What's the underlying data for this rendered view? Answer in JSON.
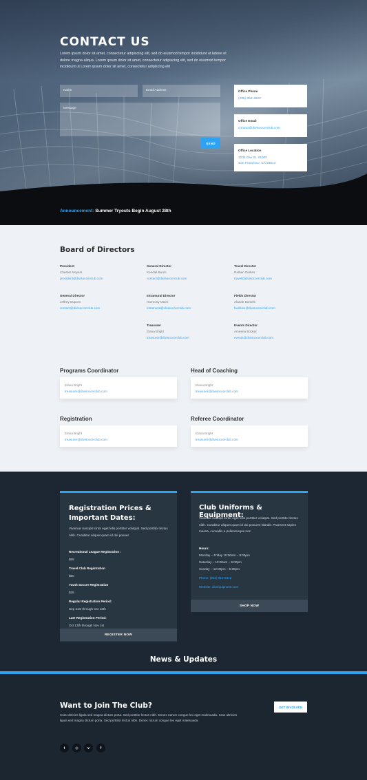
{
  "hero": {
    "title": "CONTACT US",
    "text": "Lorem ipsum dolor sit amet, consectetur adipiscing elit, sed do eiusmod tempor incididunt ut labore et dolore magna aliqua. Lorem ipsum dolor sit amet, consectetur adipiscing elit, sed do eiusmod tempor incididunt ut Lorem ipsum dolor sit amet, consectetur adipiscing elit",
    "form": {
      "name_placeholder": "Name",
      "email_placeholder": "Email Address",
      "message_placeholder": "Message",
      "send_label": "SEND"
    },
    "contact": [
      {
        "title": "Office Phone",
        "lines": [
          "(235) 352-4622"
        ]
      },
      {
        "title": "Office Email",
        "lines": [
          "contact@divisoccerclub.com"
        ]
      },
      {
        "title": "Office Location",
        "lines": [
          "1234 Divi St. #1000",
          "San Francisco, CA 93513"
        ]
      }
    ]
  },
  "announcement": {
    "label": "Announcement:",
    "text": "Summer Tryouts Begin August 28th"
  },
  "board": {
    "title": "Board of Directors",
    "members": [
      {
        "role": "President",
        "name": "Chester Meyers",
        "email": "president@divisoccerclub.com"
      },
      {
        "role": "General Director",
        "name": "Kendall Burch",
        "email": "contact@divisoccerclub.com"
      },
      {
        "role": "Travel Director",
        "name": "Rathan Parkes",
        "email": "travel@divisoccerclub.com"
      },
      {
        "role": "General Director",
        "name": "Jeffrey Dupont",
        "email": "contact@divisoccerclub.com"
      },
      {
        "role": "Intramural Director",
        "name": "Harmony Mack",
        "email": "intramural@divisoccerclub.com"
      },
      {
        "role": "Fields Director",
        "name": "Alanah Daniels",
        "email": "facilities@divisoccerclub.com"
      },
      {
        "role": "Treasurer",
        "name": "Elana Bright",
        "email": "treasurer@divisoccerclub.com"
      },
      {
        "role": "Events Director",
        "name": "Ameena Booker",
        "email": "events@divisoccerclub.com"
      }
    ],
    "coordinators": [
      {
        "title": "Programs Coordinator",
        "name": "Elana Bright",
        "email": "treasurer@divisoccerclub.com"
      },
      {
        "title": "Head of Coaching",
        "name": "Elana Bright",
        "email": "treasurer@divisoccerclub.com"
      },
      {
        "title": "Registration",
        "name": "Elana Bright",
        "email": "treasurer@divisoccerclub.com"
      },
      {
        "title": "Referee Coordinator",
        "name": "Elana Bright",
        "email": "treasurer@divisoccerclub.com"
      }
    ]
  },
  "prices": {
    "title_line1": "Registration Prices &",
    "title_line2": "Important Dates:",
    "text": "Vivamus suscipit tortor eget felis porttitor volutpat. Sed porttitor lectus nibh. Curabitur aliquet quam id dui posuer",
    "items": [
      {
        "label": "Recreational League Registration :",
        "value": "$55"
      },
      {
        "label": "Travel Club Registration",
        "value": "$90"
      },
      {
        "label": "Youth Soccer Registration",
        "value": "$28"
      },
      {
        "label": "Regular Registration Period:",
        "value": "Sep 21st through Oct 12th"
      },
      {
        "label": "Late Registration Period:",
        "value": "Oct 13th through Nov 1st"
      }
    ],
    "button": "REGISTER NOW"
  },
  "uniforms": {
    "title": "Club Uniforms & Equipment:",
    "text": "Vivamus suscipit tortor eget felis porttitor volutpat. Sed porttitor lectus nibh. Curabitur aliquet quam id dui posuere blandit. Praesent sapien massa, convallis a pellentesque nec",
    "hours_label": "Hours:",
    "hours": [
      "Monday – Friday 10:00am – 9:00pm",
      "Saturday – 10:00am – 6:00pm",
      "Sunday – 12:00pm – 5:00pm"
    ],
    "phone": "Phone: (924) 912-5312",
    "website": "Website: diviequipment.com",
    "button": "SHOP NOW"
  },
  "news": {
    "title": "News & Updates"
  },
  "join": {
    "title": "Want to Join The Club?",
    "text": "Cras ultricies ligula sed magna dictum porta. Sed porttitor lectus nibh. Donec rutrum congue leo eget malesuada. Cras ultricies ligula sed magna dictum porta. Sed porttitor lectus nibh. Donec rutrum congue leo eget malesuada.",
    "button": "GET INVOLVED",
    "social": [
      {
        "icon": "twitter-icon",
        "glyph": "t"
      },
      {
        "icon": "instagram-icon",
        "glyph": "◎"
      },
      {
        "icon": "vimeo-icon",
        "glyph": "v"
      },
      {
        "icon": "facebook-icon",
        "glyph": "f"
      }
    ]
  },
  "colors": {
    "accent": "#2ea3f2",
    "dark": "#1c2733",
    "light_bg": "#eef1f5"
  }
}
